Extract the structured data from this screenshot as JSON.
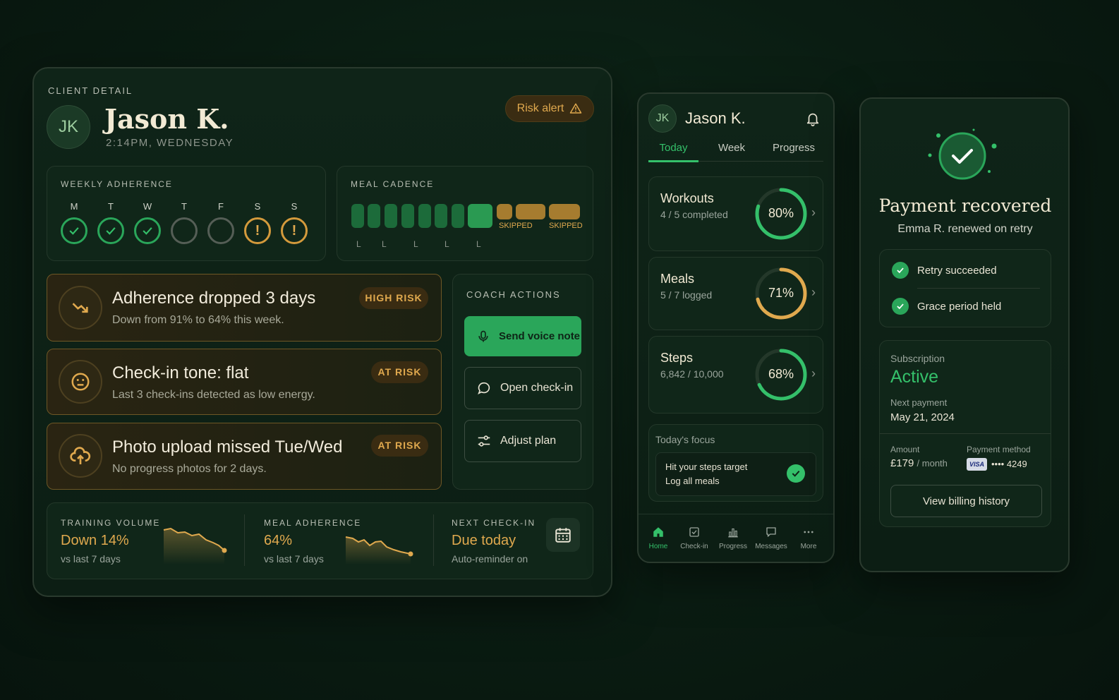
{
  "client_detail": {
    "section_label": "CLIENT DETAIL",
    "avatar_initials": "JK",
    "name": "Jason K.",
    "subtitle": "2:14PM, WEDNESDAY",
    "risk_alert": "Risk alert",
    "weekly_adherence": {
      "label": "WEEKLY ADHERENCE",
      "days": [
        {
          "d": "M",
          "status": "done"
        },
        {
          "d": "T",
          "status": "done"
        },
        {
          "d": "W",
          "status": "done"
        },
        {
          "d": "T",
          "status": "empty"
        },
        {
          "d": "F",
          "status": "empty"
        },
        {
          "d": "S",
          "status": "alert"
        },
        {
          "d": "S",
          "status": "alert"
        }
      ],
      "alert_glyph": "!"
    },
    "meal_cadence": {
      "label": "MEAL CADENCE",
      "skipped_1": "SKIPPED",
      "skipped_2": "SKIPPED",
      "l1": "L",
      "l2": "L",
      "l3": "L",
      "l4": "L",
      "l5": "L"
    },
    "risks": [
      {
        "title": "Adherence dropped 3 days",
        "desc": "Down from 91% to 64% this week.",
        "badge": "HIGH RISK",
        "icon": "trend-down-icon"
      },
      {
        "title": "Check-in tone: flat",
        "desc": "Last 3 check-ins detected as low energy.",
        "badge": "AT RISK",
        "icon": "neutral-face-icon"
      },
      {
        "title": "Photo upload missed Tue/Wed",
        "desc": "No progress photos for 2 days.",
        "badge": "AT RISK",
        "icon": "cloud-upload-icon"
      }
    ],
    "coach_actions": {
      "label": "COACH ACTIONS",
      "voice": "Send voice note",
      "checkin": "Open check-in",
      "adjust": "Adjust plan"
    },
    "stats": {
      "training_label": "TRAINING VOLUME",
      "training_value": "Down 14%",
      "training_sub": "vs last 7 days",
      "meal_label": "MEAL ADHERENCE",
      "meal_value": "64%",
      "meal_sub": "vs last 7 days",
      "next_label": "NEXT CHECK-IN",
      "next_value": "Due today",
      "next_sub": "Auto-reminder on"
    }
  },
  "mobile": {
    "avatar_initials": "JK",
    "name": "Jason K.",
    "tabs": [
      "Today",
      "Week",
      "Progress"
    ],
    "metrics": [
      {
        "title": "Workouts",
        "sub": "4 / 5 completed",
        "pct_label": "80%",
        "pct": 0.8,
        "color": "#34c06a"
      },
      {
        "title": "Meals",
        "sub": "5 / 7 logged",
        "pct_label": "71%",
        "pct": 0.71,
        "color": "#e0a94e"
      },
      {
        "title": "Steps",
        "sub": "6,842 / 10,000",
        "pct_label": "68%",
        "pct": 0.68,
        "color": "#34c06a"
      }
    ],
    "focus": {
      "label": "Today's focus",
      "line1": "Hit your steps target",
      "line2": "Log all meals"
    },
    "bottom_nav": [
      "Home",
      "Check-in",
      "Progress",
      "Messages",
      "More"
    ]
  },
  "payment": {
    "title": "Payment recovered",
    "subtitle": "Emma R. renewed on retry",
    "checks": [
      "Retry succeeded",
      "Grace period held"
    ],
    "subscription_label": "Subscription",
    "subscription_status": "Active",
    "next_payment_label": "Next payment",
    "next_payment_date": "May 21, 2024",
    "amount_label": "Amount",
    "amount_value": "£179",
    "amount_period": "/ month",
    "method_label": "Payment method",
    "card_brand": "VISA",
    "card_digits": "•••• 4249",
    "history_button": "View billing history"
  },
  "colors": {
    "accent_green": "#34c06a",
    "accent_gold": "#e0a94e",
    "bg": "#0a1c12"
  }
}
